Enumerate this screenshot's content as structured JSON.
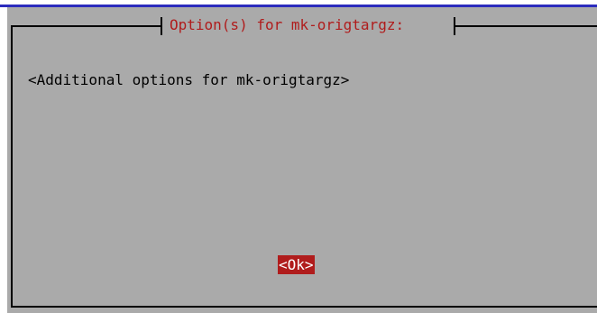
{
  "dialog": {
    "title": "Option(s) for mk-origtargz:",
    "message": "<Additional options for mk-origtargz>",
    "ok_label": "<Ok>"
  },
  "colors": {
    "dialog_background": "#aaaaaa",
    "title_text": "#b01c1c",
    "button_selected_background": "#b01c1c",
    "button_selected_text": "#ffffff",
    "top_rule": "#2b2bbd"
  }
}
